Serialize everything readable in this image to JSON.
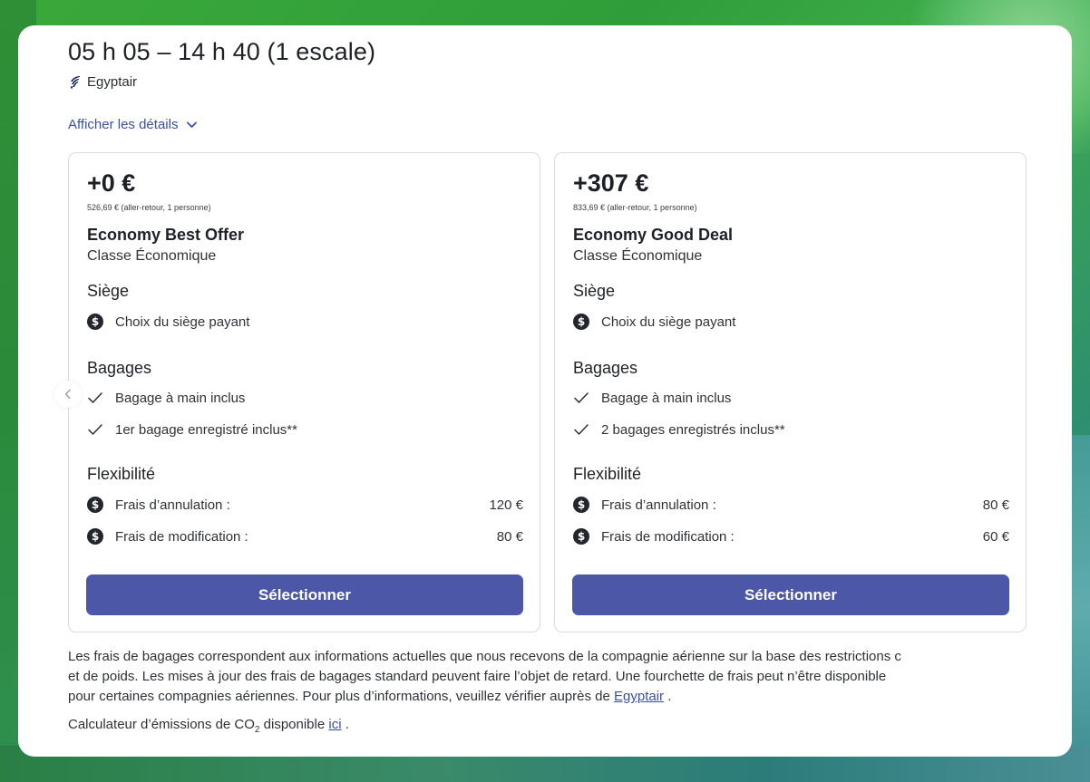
{
  "flight": {
    "title": "05 h 05 – 14 h 40 (1 escale)",
    "airline": "Egyptair"
  },
  "details_link": "Afficher les détails",
  "offers": [
    {
      "price": "+0 €",
      "price_sub": "526,69 € (aller-retour, 1 personne)",
      "fare_name": "Economy Best Offer",
      "fare_class": "Classe Économique",
      "seat_heading": "Siège",
      "seat_item": "Choix du siège payant",
      "bag_heading": "Bagages",
      "bag_items": [
        "Bagage à main inclus",
        "1er bagage enregistré inclus**"
      ],
      "flex_heading": "Flexibilité",
      "cancel_label": "Frais d’annulation :",
      "cancel_value": "120 €",
      "change_label": "Frais de modification :",
      "change_value": "80 €",
      "button": "Sélectionner"
    },
    {
      "price": "+307 €",
      "price_sub": "833,69 € (aller-retour, 1 personne)",
      "fare_name": "Economy Good Deal",
      "fare_class": "Classe Économique",
      "seat_heading": "Siège",
      "seat_item": "Choix du siège payant",
      "bag_heading": "Bagages",
      "bag_items": [
        "Bagage à main inclus",
        "2 bagages enregistrés inclus**"
      ],
      "flex_heading": "Flexibilité",
      "cancel_label": "Frais d’annulation :",
      "cancel_value": "80 €",
      "change_label": "Frais de modification :",
      "change_value": "60 €",
      "button": "Sélectionner"
    }
  ],
  "note": {
    "line1": "Les frais de bagages correspondent aux informations actuelles que nous recevons de la compagnie aérienne sur la base des restrictions c",
    "line2": "et de poids. Les mises à jour des frais de bagages standard peuvent faire l’objet de retard. Une fourchette de frais peut n’être disponible",
    "line3_pre": "pour certaines compagnies aériennes. Pour plus d’informations, veuillez vérifier auprès de",
    "line3_link": "Egyptair",
    "line3_post": "."
  },
  "co2": {
    "pre": "Calculateur d’émissions de CO",
    "sub": "2",
    "mid": " disponible",
    "link": "ici",
    "post": "."
  },
  "icons": {
    "fee": "dollar-circle-icon",
    "included": "check-icon",
    "expand": "chevron-down-icon",
    "carousel_prev": "chevron-left-icon"
  },
  "colors": {
    "accent": "#4c57a7",
    "link": "#3b4fa8"
  }
}
